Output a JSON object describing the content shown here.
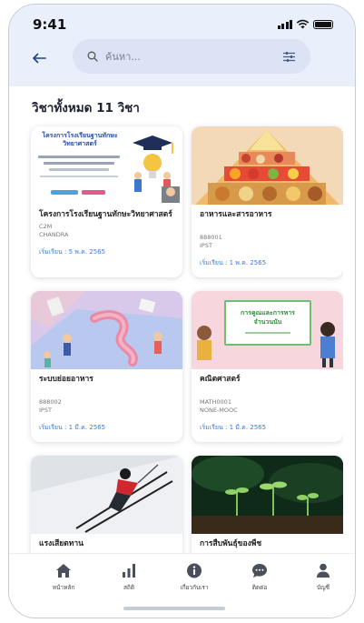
{
  "status_bar": {
    "time": "9:41"
  },
  "header": {
    "back_icon": "arrow-left-icon",
    "search": {
      "placeholder": "ค้นหา...",
      "value": ""
    },
    "filter_icon": "sliders-icon"
  },
  "section_title": "วิชาทั้งหมด 11 วิชา",
  "courses": [
    {
      "title": "โครงการโรงเรียนฐานทักษะวิทยาศาสตร์",
      "code": "C2M",
      "provider": "CHANDRA",
      "start": "เริ่มเรียน : 5 พ.ค. 2565",
      "thumb_text": "โครงการโรงเรียนฐานทักษะวิทยาศาสตร์"
    },
    {
      "title": "อาหารและสารอาหาร",
      "code": "888001",
      "provider": "IPST",
      "start": "เริ่มเรียน : 1 พ.ค. 2565"
    },
    {
      "title": "ระบบย่อยอาหาร",
      "code": "888002",
      "provider": "IPST",
      "start": "เริ่มเรียน : 1 มี.ค. 2565"
    },
    {
      "title": "คณิตศาสตร์",
      "code": "MATH0001",
      "provider": "NONE-MOOC",
      "start": "เริ่มเรียน : 1 มี.ค. 2565",
      "thumb_text": "การคูณและการหารจำนวนนับ"
    },
    {
      "title": "แรงเสียดทาน"
    },
    {
      "title": "การสืบพันธุ์ของพืช"
    }
  ],
  "bottom_nav": [
    {
      "label": "หน้าหลัก",
      "icon": "home-icon"
    },
    {
      "label": "สถิติ",
      "icon": "bar-chart-icon"
    },
    {
      "label": "เกี่ยวกับเรา",
      "icon": "info-icon"
    },
    {
      "label": "ติดต่อ",
      "icon": "chat-icon"
    },
    {
      "label": "บัญชี",
      "icon": "user-icon"
    }
  ],
  "colors": {
    "header_bg": "#e9effb",
    "search_bg": "#dbe3f4",
    "accent_blue": "#3d7bd9",
    "nav_icon": "#4a4f5c"
  }
}
